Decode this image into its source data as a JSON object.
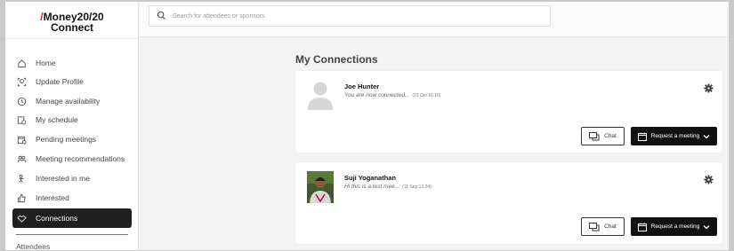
{
  "brand": {
    "logo_slash": "/",
    "logo_line1": "Money20/20",
    "logo_line2": "Connect",
    "accent": "#c2262e"
  },
  "search": {
    "placeholder": "Search for attendees or sponsors"
  },
  "sidebar": {
    "items": [
      {
        "label": "Home",
        "icon": "home-icon"
      },
      {
        "label": "Update Profile",
        "icon": "profile-icon"
      },
      {
        "label": "Manage availability",
        "icon": "clock-icon"
      },
      {
        "label": "My schedule",
        "icon": "schedule-icon"
      },
      {
        "label": "Pending meetings",
        "icon": "calendar-pending-icon"
      },
      {
        "label": "Meeting recommendations",
        "icon": "people-icon"
      },
      {
        "label": "Interested in me",
        "icon": "interested-in-me-icon"
      },
      {
        "label": "Interested",
        "icon": "thumbs-up-icon"
      },
      {
        "label": "Connections",
        "icon": "handshake-icon",
        "active": true
      }
    ],
    "section_label": "Attendees"
  },
  "main": {
    "title": "My Connections",
    "connections": [
      {
        "name": "Joe Hunter",
        "message": "You are now connected...",
        "timestamp": "(23 Oct 16:10)",
        "chat_label": "Chat",
        "request_label": "Request a meeting"
      },
      {
        "name": "Suji Yoganathan",
        "message": "Hi this is a test mee...",
        "timestamp": "(11 Sep 13:24)",
        "chat_label": "Chat",
        "request_label": "Request a meeting"
      }
    ]
  }
}
